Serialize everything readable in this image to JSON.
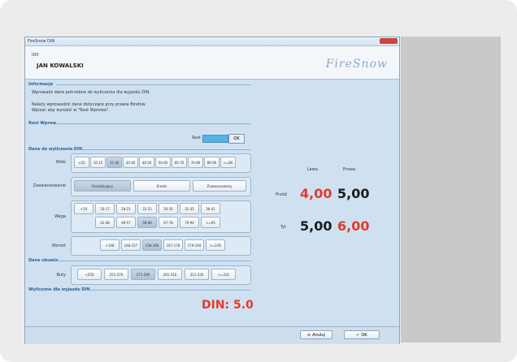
{
  "window": {
    "title": "FireSnow DIN"
  },
  "header": {
    "user_small": "ID0",
    "user_name": "JAN KOWALSKI",
    "logo": "FireSnow"
  },
  "sections": {
    "info": "Informacje",
    "height": "Rost Wprow",
    "params": "Dane do wyliczenia DIN",
    "boot": "Dane obuwia",
    "result": "Wyliczone dla wyjazdu DIN"
  },
  "info_lines": [
    "Wprowadź dane potrzebne do wyliczenia dla wyjazdu DIN.",
    "Należy wprowadzić dane dotyczące przy prawie Bindów.",
    "Wpisać aby wyrobić w \"Rost Wprowa\"."
  ],
  "height": {
    "label": "Rost",
    "button": "OK"
  },
  "age": {
    "label": "Wiek",
    "options": [
      "<10",
      "10-15",
      "15-30",
      "30-40",
      "40-50",
      "50-60",
      "60-70",
      "70-80",
      "80-90",
      ">=80"
    ],
    "selected": 2
  },
  "skill": {
    "label": "Zaawansowanie",
    "options": [
      "Początkujący",
      "Średni",
      "Zaawansowany"
    ],
    "selected": 0
  },
  "weight": {
    "label": "Waga",
    "row1": [
      "<10",
      "10-17",
      "18-21",
      "22-25",
      "26-30",
      "31-35",
      "36-41"
    ],
    "row2": [
      "42-48",
      "49-57",
      "58-66",
      "67-78",
      "79-94",
      ">=95"
    ],
    "selected_row2": 2
  },
  "height_range": {
    "label": "Wzrost",
    "options": [
      "<148",
      "148-157",
      "158-166",
      "167-178",
      "179-194",
      ">=195"
    ],
    "selected": 2
  },
  "boot": {
    "label": "Buty",
    "options": [
      "<250",
      "251-270",
      "271-290",
      "291-310",
      "311-330",
      ">=331"
    ],
    "selected": 2
  },
  "results": {
    "col_left": "Lewa",
    "col_right": "Prawa",
    "row1_label": "Przód",
    "row2_label": "Tył",
    "front_left": "4,00",
    "front_right": "5,00",
    "rear_left": "5,00",
    "rear_right": "6,00"
  },
  "din": "DIN: 5.0",
  "footer": {
    "cancel": "Anuluj",
    "ok": "OK"
  }
}
